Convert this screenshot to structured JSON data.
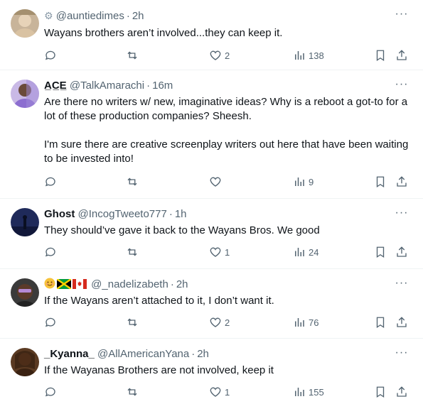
{
  "tweets": [
    {
      "display_name": "",
      "name_icon": "settings-gear-badge",
      "handle": "@auntiedimes",
      "time": "2h",
      "text": "Wayans brothers aren’t involved...they can keep it.",
      "replies": "",
      "retweets": "",
      "likes": "2",
      "views": "138"
    },
    {
      "display_name": "A̲C̲E̲",
      "handle": "@TalkAmarachi",
      "time": "16m",
      "text": "Are there no writers w/ new, imaginative ideas? Why is a reboot a got-to for a lot of these production companies? Sheesh.\n\nI'm sure there are creative screenplay writers out here that have been waiting to be invested into!",
      "replies": "",
      "retweets": "",
      "likes": "",
      "views": "9"
    },
    {
      "display_name": "Ghost",
      "handle": "@IncogTweeto777",
      "time": "1h",
      "text": "They should’ve gave it back to the Wayans Bros. We good",
      "replies": "",
      "retweets": "",
      "likes": "1",
      "views": "24"
    },
    {
      "display_name": "",
      "name_icons": [
        "smiling-face-emoji",
        "jamaica-flag",
        "canada-flag"
      ],
      "handle": "@_nadelizabeth",
      "time": "2h",
      "text": "If the Wayans aren’t attached to it, I don’t want it.",
      "replies": "",
      "retweets": "",
      "likes": "2",
      "views": "76"
    },
    {
      "display_name": "_Kyanna_",
      "handle": "@AllAmericanYana",
      "time": "2h",
      "text": "If the Wayanas Brothers are not involved, keep it",
      "replies": "",
      "retweets": "",
      "likes": "1",
      "views": "155"
    }
  ],
  "more_label": "···",
  "dot": "·",
  "colors": {
    "text": "#0f1419",
    "muted": "#536471",
    "divider": "#eff3f4"
  }
}
